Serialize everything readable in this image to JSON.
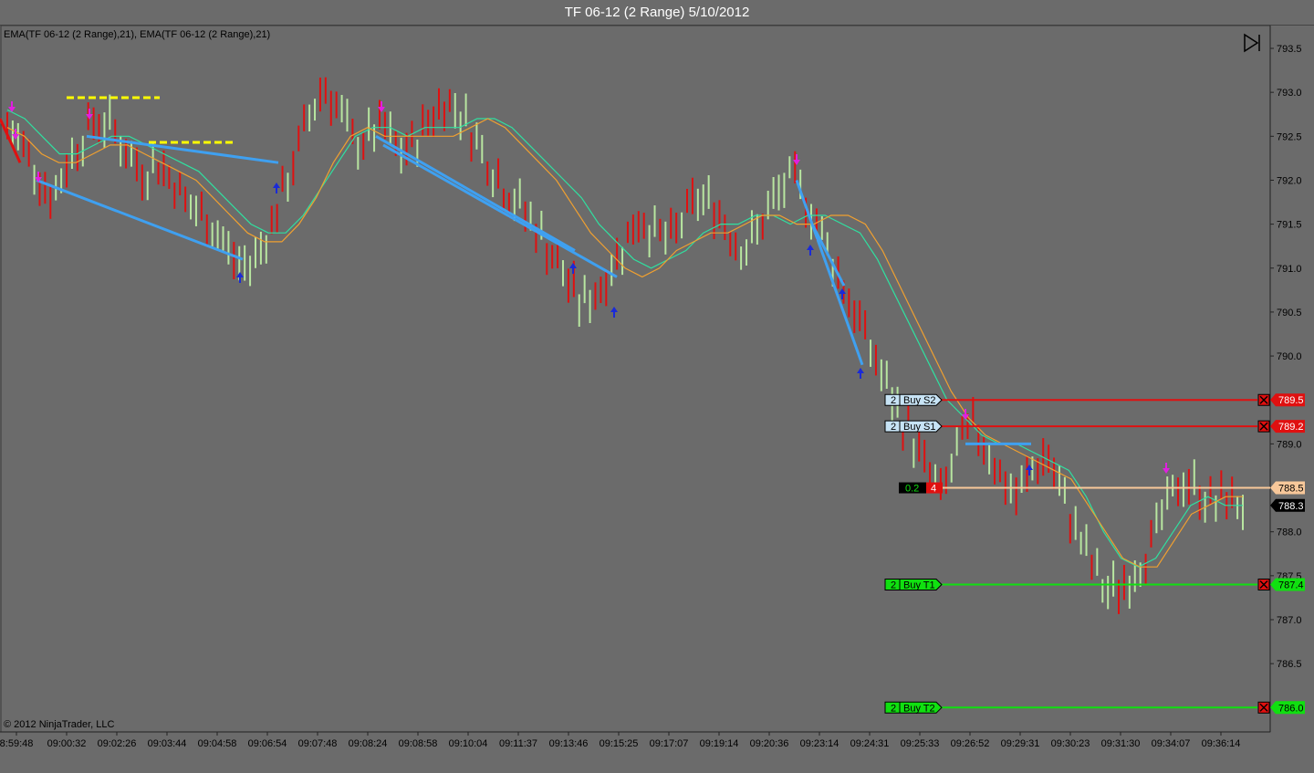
{
  "window": {
    "title": "TF 06-12 (2 Range)  5/10/2012"
  },
  "indicator_label": "EMA(TF 06-12 (2 Range),21), EMA(TF 06-12 (2 Range),21)",
  "copyright": "© 2012 NinjaTrader, LLC",
  "colors": {
    "background": "#6b6b6b",
    "up_bar": "#b8e6a0",
    "down_bar": "#e01010",
    "ema_fast": "#f0a030",
    "ema_slow": "#30e0a0",
    "trendline": "#3fa0f0",
    "target_line": "#10e010",
    "stop_line": "#e01010",
    "entry_line": "#f8c89a",
    "resistance_dash": "#ffff00"
  },
  "orders": [
    {
      "label": "Buy S2",
      "qty": "2",
      "price": 789.5,
      "price_text": "789.5",
      "kind": "stop"
    },
    {
      "label": "Buy S1",
      "qty": "2",
      "price": 789.2,
      "price_text": "789.2",
      "kind": "stop"
    },
    {
      "label": "Buy T1",
      "qty": "2",
      "price": 787.4,
      "price_text": "787.4",
      "kind": "target"
    },
    {
      "label": "Buy T2",
      "qty": "2",
      "price": 786.0,
      "price_text": "786.0",
      "kind": "target"
    }
  ],
  "position": {
    "pnl": "0.2",
    "qty": "4",
    "price": 788.5,
    "price_text": "788.5"
  },
  "last_price": {
    "price": 788.3,
    "text": "788.3"
  },
  "chart_data": {
    "type": "ohlc-range-bars",
    "title": "TF 06-12 (2 Range)  5/10/2012",
    "ylim": [
      786.1,
      793.7
    ],
    "y_ticks": [
      "793.5",
      "793.0",
      "792.5",
      "792.0",
      "791.5",
      "791.0",
      "790.5",
      "790.0",
      "789.0",
      "788.0",
      "787.5",
      "787.0",
      "786.5"
    ],
    "x_ticks": [
      "8:59:48",
      "09:00:32",
      "09:02:26",
      "09:03:44",
      "09:04:58",
      "09:06:54",
      "09:07:48",
      "09:08:24",
      "09:08:58",
      "09:10:04",
      "09:11:37",
      "09:13:46",
      "09:15:25",
      "09:17:07",
      "09:19:14",
      "09:20:36",
      "09:23:14",
      "09:24:31",
      "09:25:33",
      "09:26:52",
      "09:29:31",
      "09:30:23",
      "09:31:30",
      "09:34:07",
      "09:36:14"
    ],
    "close_path": [
      792.6,
      792.4,
      792.1,
      791.8,
      792.2,
      792.5,
      792.7,
      792.6,
      792.3,
      792.1,
      792.2,
      792.0,
      791.7,
      791.6,
      791.4,
      791.1,
      791.0,
      791.3,
      791.7,
      792.2,
      792.7,
      793.1,
      792.8,
      792.4,
      792.5,
      792.6,
      792.3,
      792.4,
      792.7,
      792.9,
      792.8,
      792.5,
      792.2,
      791.9,
      791.7,
      791.5,
      791.2,
      790.9,
      790.6,
      790.7,
      791.0,
      791.3,
      791.6,
      791.4,
      791.3,
      791.6,
      791.8,
      791.7,
      791.4,
      791.2,
      791.5,
      791.8,
      792.0,
      791.8,
      791.4,
      791.0,
      790.6,
      790.2,
      789.8,
      789.4,
      789.1,
      788.7,
      788.4,
      788.9,
      789.2,
      789.0,
      788.6,
      788.4,
      788.7,
      788.9,
      788.4,
      788.0,
      787.6,
      787.3,
      787.4,
      787.6,
      787.9,
      788.3,
      788.6,
      788.5,
      788.3,
      788.4,
      788.3
    ],
    "ema_fast": [
      792.6,
      792.5,
      792.3,
      792.2,
      792.2,
      792.3,
      792.4,
      792.4,
      792.3,
      792.2,
      792.1,
      792.0,
      791.8,
      791.6,
      791.4,
      791.3,
      791.3,
      791.5,
      791.8,
      792.2,
      792.5,
      792.6,
      792.5,
      792.5,
      792.5,
      792.5,
      792.5,
      792.6,
      792.7,
      792.6,
      792.4,
      792.2,
      792.0,
      791.7,
      791.4,
      791.2,
      791.0,
      790.9,
      791.0,
      791.2,
      791.3,
      791.4,
      791.4,
      791.5,
      791.6,
      791.6,
      791.5,
      791.5,
      791.6,
      791.6,
      791.5,
      791.2,
      790.8,
      790.4,
      790.0,
      789.6,
      789.3,
      789.1,
      789.0,
      788.9,
      788.8,
      788.7,
      788.6,
      788.3,
      788.0,
      787.7,
      787.6,
      787.6,
      787.9,
      788.2,
      788.3,
      788.4,
      788.4
    ],
    "ema_slow": [
      792.8,
      792.7,
      792.5,
      792.3,
      792.3,
      792.4,
      792.5,
      792.5,
      792.4,
      792.3,
      792.2,
      792.1,
      791.9,
      791.7,
      791.5,
      791.4,
      791.4,
      791.6,
      791.9,
      792.2,
      792.5,
      792.6,
      792.6,
      792.5,
      792.6,
      792.6,
      792.6,
      792.7,
      792.7,
      792.6,
      792.4,
      792.2,
      792.0,
      791.8,
      791.5,
      791.3,
      791.1,
      791.0,
      791.1,
      791.2,
      791.4,
      791.5,
      791.5,
      791.6,
      791.6,
      791.5,
      791.6,
      791.6,
      791.5,
      791.4,
      791.1,
      790.7,
      790.3,
      789.9,
      789.5,
      789.3,
      789.1,
      789.0,
      789.0,
      788.9,
      788.8,
      788.7,
      788.4,
      788.0,
      787.7,
      787.6,
      787.7,
      788.0,
      788.3,
      788.4,
      788.3,
      788.3
    ]
  }
}
